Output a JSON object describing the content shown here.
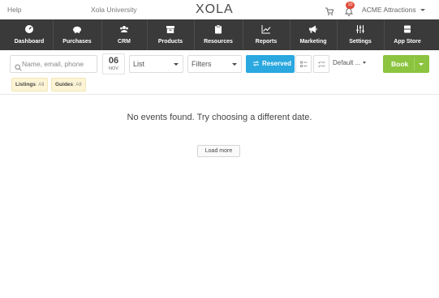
{
  "topbar": {
    "help": "Help",
    "university": "Xola University",
    "logo": "XOLA",
    "notification_count": "10",
    "account": "ACME Attractions"
  },
  "nav": {
    "items": [
      {
        "label": "Dashboard",
        "icon": "gauge-icon"
      },
      {
        "label": "Purchases",
        "icon": "piggy-bank-icon"
      },
      {
        "label": "CRM",
        "icon": "people-icon"
      },
      {
        "label": "Products",
        "icon": "box-icon"
      },
      {
        "label": "Resources",
        "icon": "clipboard-icon"
      },
      {
        "label": "Reports",
        "icon": "line-chart-icon"
      },
      {
        "label": "Marketing",
        "icon": "megaphone-icon"
      },
      {
        "label": "Settings",
        "icon": "sliders-icon"
      },
      {
        "label": "App Store",
        "icon": "app-store-icon"
      }
    ]
  },
  "toolbar": {
    "search_placeholder": "Name, email, phone",
    "date_day": "06",
    "date_month": "NOV",
    "view_select": "List",
    "filters_select": "Filters",
    "reserved_label": "Reserved",
    "sort_select": "Default ...",
    "book_label": "Book"
  },
  "filters": {
    "listings_label": "Listings",
    "listings_value": ": All",
    "guides_label": "Guides",
    "guides_value": ": All"
  },
  "main": {
    "empty_message": "No events found. Try choosing a different date.",
    "load_more": "Load more"
  },
  "colors": {
    "nav_bg": "#3a3a3a",
    "reserved_bg": "#2aa8df",
    "book_bg": "#8cc43f",
    "badge_bg": "#e04a3a",
    "chip_bg": "#fcf4d4"
  }
}
